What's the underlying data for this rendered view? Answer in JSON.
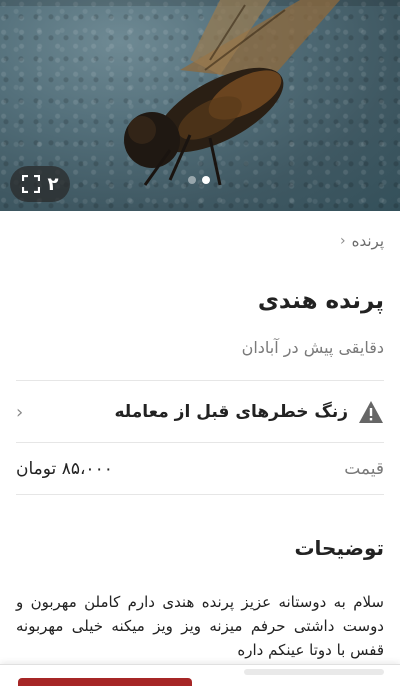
{
  "gallery": {
    "count": "۲",
    "dots": 2,
    "active_dot": 2
  },
  "breadcrumb": {
    "category": "پرنده"
  },
  "ad": {
    "title": "پرنده هندی",
    "subtitle": "دقایقی پیش در آبادان"
  },
  "warning": {
    "label": "زنگ خطرهای قبل از معامله",
    "icon": "warning-triangle-icon"
  },
  "price": {
    "label": "قیمت",
    "value": "۸۵،۰۰۰ تومان"
  },
  "description": {
    "title": "توضیحات",
    "text": "سلام به دوستانه عزیز پرنده هندی دارم کاملن مهربون و دوست داشتی حرفم میزنه ویز ویز میکنه خیلی مهربونه قفس با دوتا عینکم داره"
  },
  "colors": {
    "accent": "#a62626"
  }
}
